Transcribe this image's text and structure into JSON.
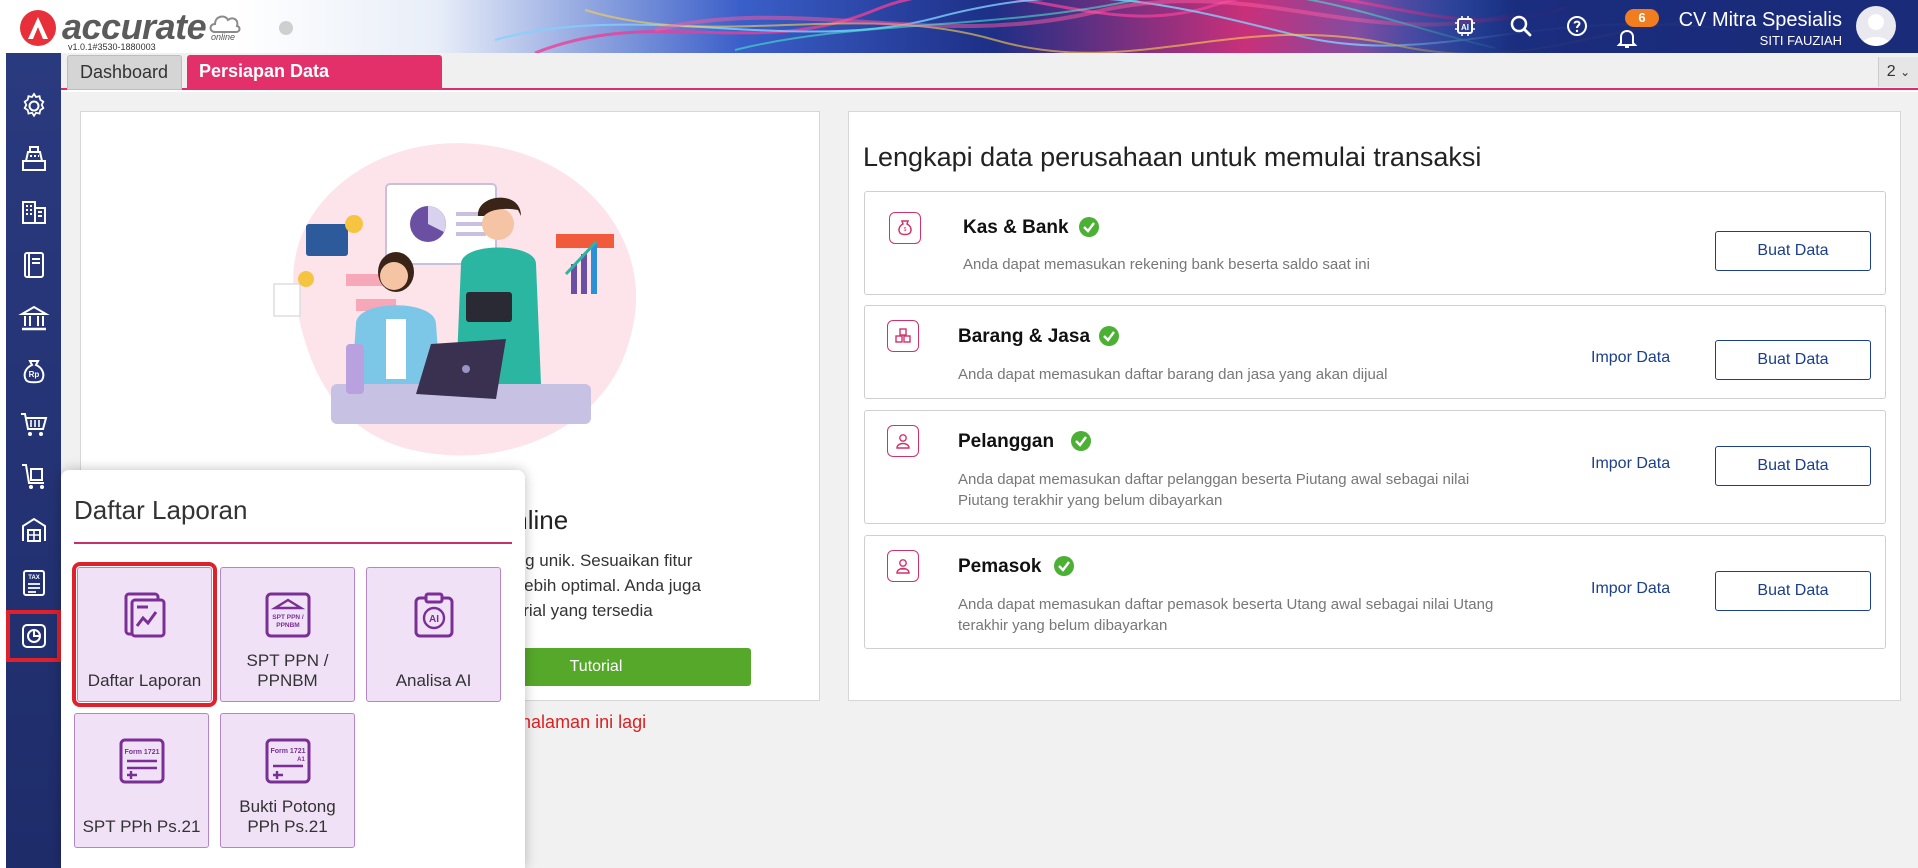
{
  "app": {
    "logo_text": "accurate",
    "logo_sub": "online",
    "version": "v1.0.1#3530-1880003",
    "notification_count": "6",
    "company_name": "CV Mitra Spesialis",
    "user_name": "SITI FAUZIAH"
  },
  "header": {
    "icons": [
      "ai-chip-icon",
      "search-icon",
      "help-icon",
      "bell-icon"
    ]
  },
  "tabs": [
    {
      "label": "Dashboard",
      "active": false
    },
    {
      "label": "Persiapan Data Perusahaan",
      "active": true
    }
  ],
  "tab_count": "2",
  "sidebar": {
    "items": [
      {
        "icon": "gear-icon"
      },
      {
        "icon": "cash-register-icon"
      },
      {
        "icon": "building-icon"
      },
      {
        "icon": "ledger-book-icon"
      },
      {
        "icon": "bank-icon"
      },
      {
        "icon": "money-bag-icon"
      },
      {
        "icon": "cart-icon"
      },
      {
        "icon": "delivery-cart-icon"
      },
      {
        "icon": "warehouse-icon"
      },
      {
        "icon": "tax-document-icon"
      },
      {
        "icon": "report-chart-icon"
      }
    ],
    "active_index": 10
  },
  "welcome": {
    "title_fragment": "rate Online",
    "desc_lines": [
      "utuhan yang unik. Sesuaikan fitur",
      "man yang lebih optimal. Anda juga",
      "nelalui tutorial yang tersedia"
    ],
    "tutorial_label": "Tutorial",
    "dont_show_prefix": "n",
    "dont_show_link": "halaman ini lagi"
  },
  "setup": {
    "title": "Lengkapi data perusahaan untuk memulai transaksi",
    "tasks": [
      {
        "title": "Kas & Bank",
        "desc": "Anda dapat memasukan rekening bank beserta saldo saat ini",
        "impor_label": "",
        "buat_label": "Buat Data",
        "icon": "money-bag-icon",
        "done": true
      },
      {
        "title": "Barang & Jasa",
        "desc": "Anda dapat memasukan daftar barang dan jasa yang akan dijual",
        "impor_label": "Impor Data",
        "buat_label": "Buat Data",
        "icon": "boxes-icon",
        "done": true
      },
      {
        "title": "Pelanggan",
        "desc": "Anda dapat memasukan daftar pelanggan beserta Piutang awal sebagai nilai Piutang terakhir yang belum dibayarkan",
        "impor_label": "Impor Data",
        "buat_label": "Buat Data",
        "icon": "customer-icon",
        "done": true
      },
      {
        "title": "Pemasok",
        "desc": "Anda dapat memasukan daftar pemasok beserta Utang awal sebagai nilai Utang terakhir yang belum dibayarkan",
        "impor_label": "Impor Data",
        "buat_label": "Buat Data",
        "icon": "supplier-icon",
        "done": true
      }
    ]
  },
  "report_popup": {
    "title": "Daftar Laporan",
    "items": [
      {
        "label": "Daftar Laporan",
        "icon": "report-document-icon",
        "icon_text": ""
      },
      {
        "label": "SPT PPN / PPNBM",
        "icon": "spt-ppn-icon",
        "icon_text": "SPT PPN / PPNBM"
      },
      {
        "label": "Analisa AI",
        "icon": "ai-clipboard-icon",
        "icon_text": "AI"
      },
      {
        "label": "SPT PPh Ps.21",
        "icon": "form-1721-icon",
        "icon_text": "Form 1721"
      },
      {
        "label": "Bukti Potong PPh Ps.21",
        "icon": "form-1721-a1-icon",
        "icon_text": "Form 1721 A1"
      }
    ],
    "active_index": 0
  },
  "colors": {
    "brand_red": "#e8303a",
    "tab_active": "#e4306a",
    "sidebar": "#1e2c6a",
    "tile_bg": "#f0e1f7",
    "tile_icon": "#7a2f96",
    "button_blue": "#1b3f8b",
    "tutorial_green": "#56a82a",
    "check_green": "#4cb034",
    "highlight": "#e0202a"
  }
}
